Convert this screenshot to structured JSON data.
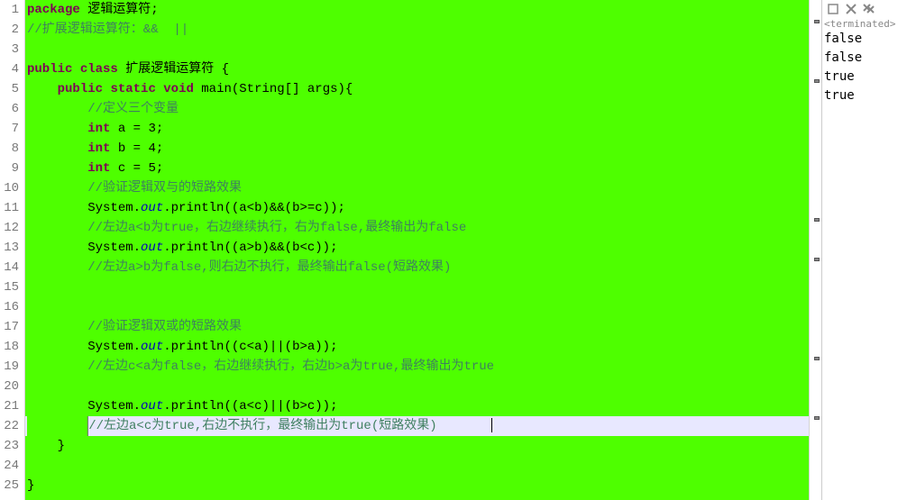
{
  "editor": {
    "lines": [
      {
        "n": 1,
        "type": "code",
        "tokens": [
          {
            "cls": "kw",
            "t": "package"
          },
          {
            "cls": "plain",
            "t": " 逻辑运算符;"
          }
        ]
      },
      {
        "n": 2,
        "type": "cmt",
        "tokens": [
          {
            "cls": "cmt",
            "t": "//扩展逻辑运算符：&&  ||"
          }
        ]
      },
      {
        "n": 3,
        "type": "blank",
        "tokens": []
      },
      {
        "n": 4,
        "type": "code",
        "tokens": [
          {
            "cls": "kw",
            "t": "public"
          },
          {
            "cls": "plain",
            "t": " "
          },
          {
            "cls": "kw",
            "t": "class"
          },
          {
            "cls": "plain",
            "t": " 扩展逻辑运算符 {"
          }
        ]
      },
      {
        "n": 5,
        "type": "code",
        "indent": "    ",
        "tokens": [
          {
            "cls": "kw",
            "t": "public"
          },
          {
            "cls": "plain",
            "t": " "
          },
          {
            "cls": "kw",
            "t": "static"
          },
          {
            "cls": "plain",
            "t": " "
          },
          {
            "cls": "kw",
            "t": "void"
          },
          {
            "cls": "plain",
            "t": " main(String[] args){"
          }
        ]
      },
      {
        "n": 6,
        "type": "cmt",
        "indent": "        ",
        "tokens": [
          {
            "cls": "cmt",
            "t": "//定义三个变量"
          }
        ]
      },
      {
        "n": 7,
        "type": "code",
        "indent": "        ",
        "tokens": [
          {
            "cls": "kw",
            "t": "int"
          },
          {
            "cls": "plain",
            "t": " a = 3;"
          }
        ]
      },
      {
        "n": 8,
        "type": "code",
        "indent": "        ",
        "tokens": [
          {
            "cls": "kw",
            "t": "int"
          },
          {
            "cls": "plain",
            "t": " b = 4;"
          }
        ]
      },
      {
        "n": 9,
        "type": "code",
        "indent": "        ",
        "tokens": [
          {
            "cls": "kw",
            "t": "int"
          },
          {
            "cls": "plain",
            "t": " c = 5;"
          }
        ]
      },
      {
        "n": 10,
        "type": "cmt",
        "indent": "        ",
        "tokens": [
          {
            "cls": "cmt",
            "t": "//验证逻辑双与的短路效果"
          }
        ]
      },
      {
        "n": 11,
        "type": "code",
        "indent": "        ",
        "tokens": [
          {
            "cls": "plain",
            "t": "System."
          },
          {
            "cls": "field",
            "t": "out"
          },
          {
            "cls": "plain",
            "t": ".println((a<b)&&(b>=c));"
          }
        ]
      },
      {
        "n": 12,
        "type": "cmt",
        "indent": "        ",
        "tokens": [
          {
            "cls": "cmt",
            "t": "//左边a<b为true，右边继续执行，右为false,最终输出为false"
          }
        ]
      },
      {
        "n": 13,
        "type": "code",
        "indent": "        ",
        "tokens": [
          {
            "cls": "plain",
            "t": "System."
          },
          {
            "cls": "field",
            "t": "out"
          },
          {
            "cls": "plain",
            "t": ".println((a>b)&&(b<c));"
          }
        ]
      },
      {
        "n": 14,
        "type": "cmt",
        "indent": "        ",
        "tokens": [
          {
            "cls": "cmt",
            "t": "//左边a>b为false,则右边不执行，最终输出false(短路效果)"
          }
        ]
      },
      {
        "n": 15,
        "type": "blank",
        "indent": "        ",
        "tokens": []
      },
      {
        "n": 16,
        "type": "blank",
        "indent": "        ",
        "tokens": []
      },
      {
        "n": 17,
        "type": "cmt",
        "indent": "        ",
        "tokens": [
          {
            "cls": "cmt",
            "t": "//验证逻辑双或的短路效果"
          }
        ]
      },
      {
        "n": 18,
        "type": "code",
        "indent": "        ",
        "tokens": [
          {
            "cls": "plain",
            "t": "System."
          },
          {
            "cls": "field",
            "t": "out"
          },
          {
            "cls": "plain",
            "t": ".println((c<a)||(b>a));"
          }
        ]
      },
      {
        "n": 19,
        "type": "cmt",
        "indent": "        ",
        "tokens": [
          {
            "cls": "cmt",
            "t": "//左边c<a为false，右边继续执行，右边b>a为true,最终输出为true"
          }
        ]
      },
      {
        "n": 20,
        "type": "blank",
        "indent": "        ",
        "tokens": []
      },
      {
        "n": 21,
        "type": "code",
        "indent": "        ",
        "tokens": [
          {
            "cls": "plain",
            "t": "System."
          },
          {
            "cls": "field",
            "t": "out"
          },
          {
            "cls": "plain",
            "t": ".println((a<c)||(b>c));"
          }
        ]
      },
      {
        "n": 22,
        "type": "cmt-hl",
        "indent": "        ",
        "tokens": [
          {
            "cls": "cmt",
            "t": "//左边a<c为true,右边不执行，最终输出为true(短路效果)"
          }
        ]
      },
      {
        "n": 23,
        "type": "code",
        "indent": "    ",
        "tokens": [
          {
            "cls": "plain",
            "t": "}"
          }
        ]
      },
      {
        "n": 24,
        "type": "blank",
        "tokens": []
      },
      {
        "n": 25,
        "type": "code",
        "tokens": [
          {
            "cls": "plain",
            "t": "}"
          }
        ]
      }
    ]
  },
  "console": {
    "terminated_label": "<terminated>",
    "output": [
      "false",
      "false",
      "true",
      "true"
    ]
  }
}
